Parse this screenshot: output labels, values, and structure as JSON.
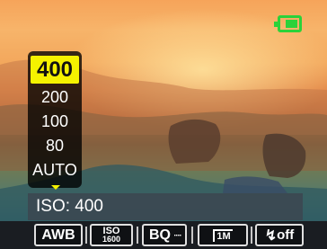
{
  "battery": {
    "icon": "battery-icon",
    "color": "#2bd23a",
    "level": 0.8
  },
  "iso_menu": {
    "selected": "400",
    "options": [
      "200",
      "100",
      "80",
      "AUTO"
    ],
    "highlight_color": "#f5f200"
  },
  "status": {
    "text": "ISO: 400"
  },
  "toolbar": {
    "awb_label": "AWB",
    "iso_line1": "ISO",
    "iso_line2": "1600",
    "quality_label": "BQ",
    "size_label": "1M",
    "flash_label": "off"
  }
}
